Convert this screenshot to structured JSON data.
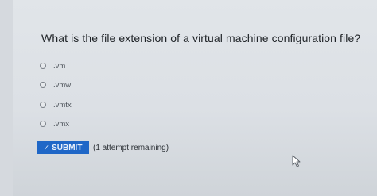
{
  "question": {
    "text": "What is the file extension of a virtual machine configuration file?"
  },
  "options": [
    {
      "label": ".vm"
    },
    {
      "label": ".vmw"
    },
    {
      "label": ".vmtx"
    },
    {
      "label": ".vmx"
    }
  ],
  "submit": {
    "label": "SUBMIT",
    "icon": "check-icon"
  },
  "attempts_text": "(1 attempt remaining)",
  "colors": {
    "accent": "#1f67c7",
    "background": "#dce0e5"
  }
}
